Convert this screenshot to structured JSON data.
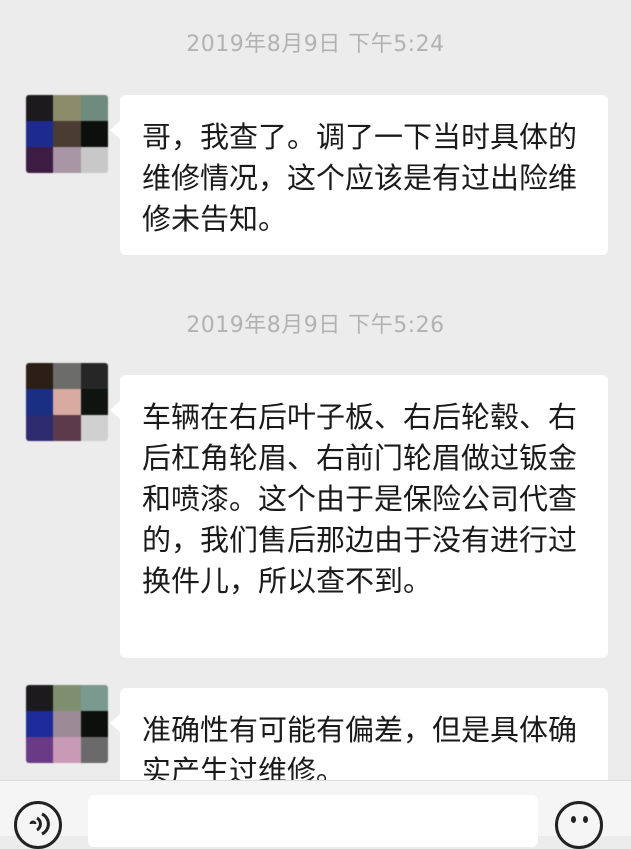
{
  "messages": [
    {
      "timestamp": "2019年8月9日 下午5:24",
      "text": "哥，我查了。调了一下当时具体的维修情况，这个应该是有过出险维修未告知。"
    },
    {
      "timestamp": "2019年8月9日 下午5:26",
      "text": "车辆在右后叶子板、右后轮毂、右后杠角轮眉、右前门轮眉做过钣金和喷漆。这个由于是保险公司代查的，我们售后那边由于没有进行过换件儿，所以查不到。"
    },
    {
      "text": "准确性有可能有偏差，但是具体确实产生过维修。"
    }
  ],
  "input_bar": {
    "voice_icon": "voice-icon",
    "emoji_icon": "emoji-icon",
    "input_value": ""
  },
  "colors": {
    "background": "#ececec",
    "bubble": "#ffffff",
    "timestamp": "#b2b2b2"
  }
}
